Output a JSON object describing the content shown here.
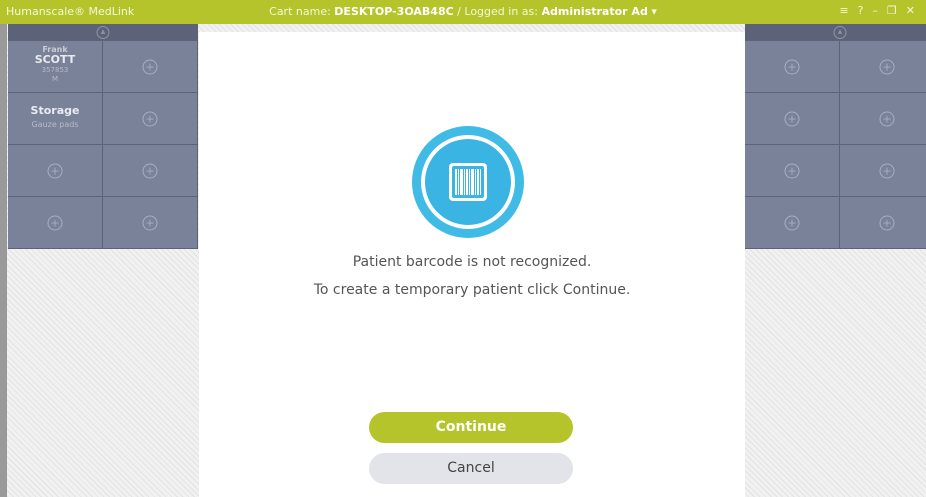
{
  "titlebar": {
    "app_name": "Humanscale® MedLink",
    "cart_label": "Cart name:",
    "cart_name": "DESKTOP-3OAB48C",
    "separator": "/",
    "logged_label": "Logged in as:",
    "user_name": "Administrator Ad",
    "dropdown_glyph": "▾",
    "menu_glyph": "≡",
    "help_glyph": "?",
    "minimize_glyph": "–",
    "restore_glyph": "❐",
    "close_glyph": "✕"
  },
  "left_panel": {
    "patient": {
      "first": "Frank",
      "last": "SCOTT",
      "id": "357853",
      "sex": "M"
    },
    "storage": {
      "title": "Storage",
      "subtitle": "Gauze pads"
    }
  },
  "modal": {
    "line1": "Patient barcode is not recognized.",
    "line2": "To create a temporary patient click Continue.",
    "continue_label": "Continue",
    "cancel_label": "Cancel"
  },
  "colors": {
    "accent": "#b5c42a",
    "barcode_blue": "#3fbbe6",
    "drawer": "#7a8299"
  }
}
